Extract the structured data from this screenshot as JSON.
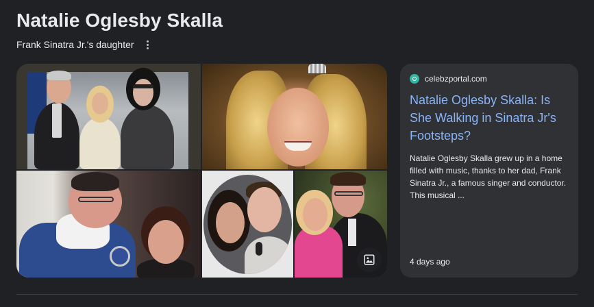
{
  "header": {
    "title": "Natalie Oglesby Skalla",
    "subtitle": "Frank Sinatra Jr.'s daughter"
  },
  "gallery": {
    "images": [
      {
        "alt": "Three people standing together"
      },
      {
        "alt": "Blonde woman wearing a tiara"
      },
      {
        "alt": "Man in blue jacket with older woman"
      },
      {
        "alt": "Couple posing in a circular portrait"
      },
      {
        "alt": "Blonde woman with man in suit"
      }
    ],
    "badge_icon": "image-search-icon"
  },
  "card": {
    "source": "celebzportal.com",
    "favicon_color": "#33b5a0",
    "title": "Natalie Oglesby Skalla: Is She Walking in Sinatra Jr's Footsteps?",
    "snippet": "Natalie Oglesby Skalla grew up in a home filled with music, thanks to her dad, Frank Sinatra Jr., a famous singer and conductor. This musical ...",
    "age": "4 days ago"
  },
  "colors": {
    "background": "#202124",
    "card": "#303134",
    "link": "#8ab4f8",
    "text": "#e8eaed"
  }
}
